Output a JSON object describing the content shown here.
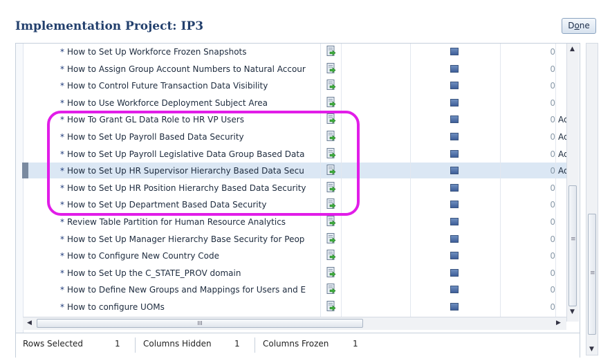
{
  "header": {
    "title": "Implementation Project: IP3"
  },
  "toolbar": {
    "done_prefix": "D",
    "done_underlined": "o",
    "done_suffix": "ne"
  },
  "icons": {
    "task_icon": "go-to-task-icon",
    "status_icon": "status-square-icon"
  },
  "rows": [
    {
      "name": "How to Set Up Workforce Frozen Snapshots",
      "count": "0",
      "assignee": ""
    },
    {
      "name": "How to Assign Group Account Numbers to Natural Accour",
      "count": "0",
      "assignee": ""
    },
    {
      "name": "How to Control Future Transaction Data Visibility",
      "count": "0",
      "assignee": ""
    },
    {
      "name": "How to Use Workforce Deployment Subject Area",
      "count": "0",
      "assignee": ""
    },
    {
      "name": "How To Grant GL Data Role to HR VP Users",
      "count": "0",
      "assignee": "Adm"
    },
    {
      "name": "How to Set Up Payroll Based Data Security",
      "count": "0",
      "assignee": "Adm"
    },
    {
      "name": "How to Set Up Payroll Legislative Data Group Based Data",
      "count": "0",
      "assignee": "Adm"
    },
    {
      "name": "How to Set Up HR Supervisor Hierarchy Based Data Secu",
      "count": "0",
      "assignee": "Adm"
    },
    {
      "name": "How to Set Up HR Position Hierarchy Based Data Security",
      "count": "0",
      "assignee": ""
    },
    {
      "name": "How to Set Up Department Based Data Security",
      "count": "0",
      "assignee": ""
    },
    {
      "name": "Review Table Partition for Human Resource Analytics",
      "count": "0",
      "assignee": ""
    },
    {
      "name": "How to Set Up Manager Hierarchy Base Security for Peop",
      "count": "0",
      "assignee": ""
    },
    {
      "name": "How to Configure New Country Code",
      "count": "0",
      "assignee": ""
    },
    {
      "name": "How to Set Up the C_STATE_PROV domain",
      "count": "0",
      "assignee": ""
    },
    {
      "name": "How to Define New Groups and Mappings for Users and E",
      "count": "0",
      "assignee": ""
    },
    {
      "name": "How to configure UOMs",
      "count": "0",
      "assignee": ""
    }
  ],
  "status": {
    "rows_selected_label": "Rows Selected",
    "rows_selected_value": "1",
    "columns_hidden_label": "Columns Hidden",
    "columns_hidden_value": "1",
    "columns_frozen_label": "Columns Frozen",
    "columns_frozen_value": "1"
  },
  "hscroll": {
    "grip": "III"
  },
  "vscroll": {
    "grip": "≡"
  },
  "colors": {
    "header": "#23406d",
    "highlight": "#e11de8",
    "selected_row": "#dbe7f4"
  }
}
